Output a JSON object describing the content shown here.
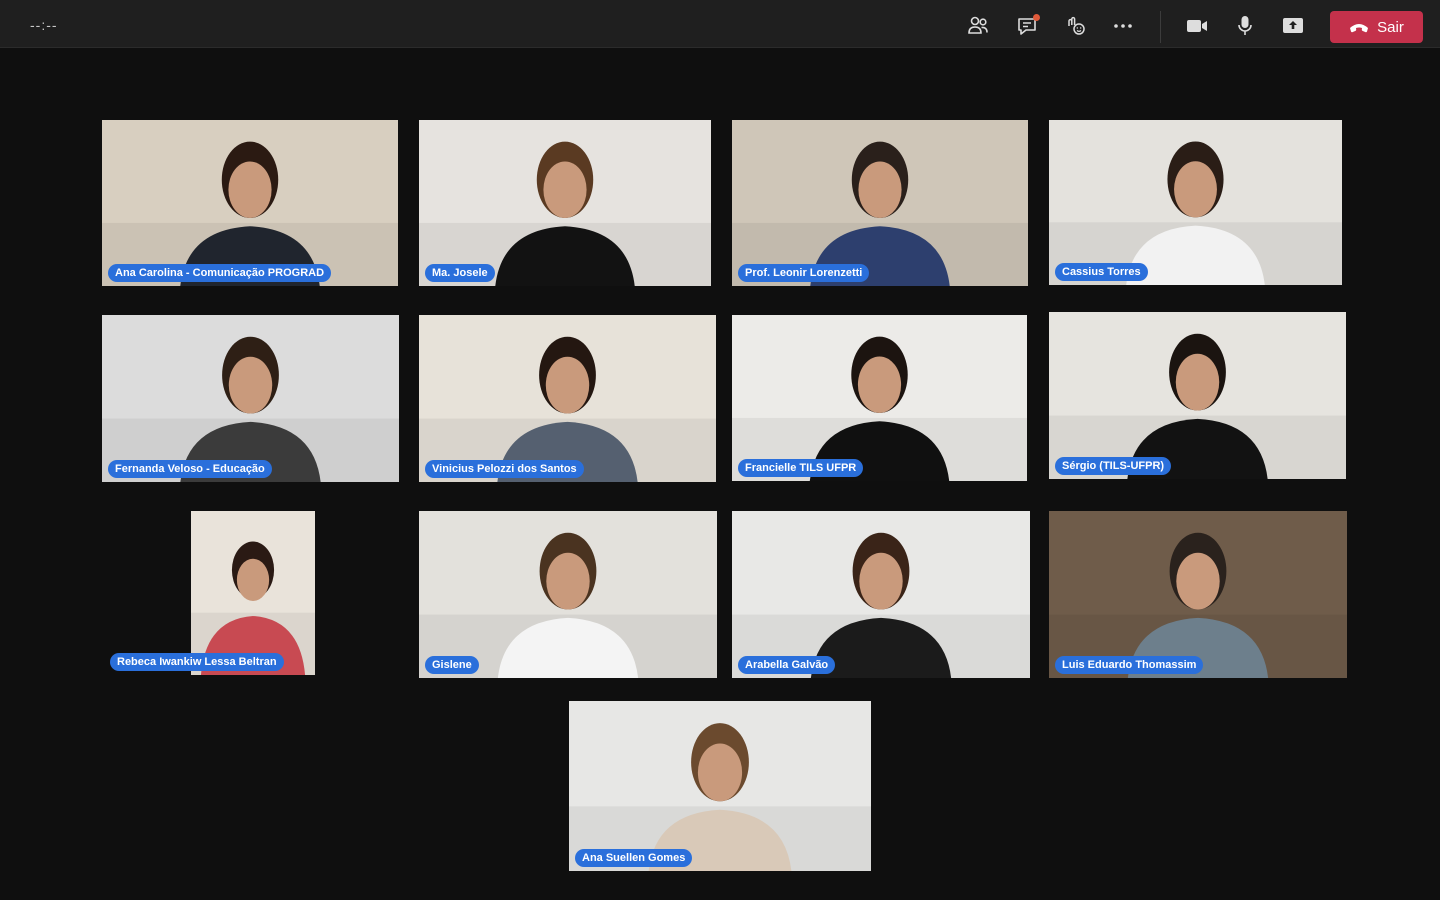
{
  "meeting": {
    "timer": "--:--",
    "toolbar": {
      "people_icon": "people-icon",
      "chat_icon": "chat-icon",
      "reactions_icon": "reactions-icon",
      "more_icon": "more-options-icon",
      "camera_icon": "camera-icon",
      "mic_icon": "microphone-icon",
      "share_icon": "share-screen-icon",
      "leave_label": "Sair",
      "leave_color": "#c4314b"
    }
  },
  "participants": [
    {
      "name": "Ana Carolina - Comunicação PROGRAD",
      "wall": "#d8cfc0",
      "shirt": "#20252e",
      "hair": "#2b1a12"
    },
    {
      "name": "Ma. Josele",
      "wall": "#e6e3df",
      "shirt": "#121212",
      "hair": "#5a3a22"
    },
    {
      "name": "Prof. Leonir Lorenzetti",
      "wall": "#cfc6b8",
      "shirt": "#2d3f6e",
      "hair": "#2a201b"
    },
    {
      "name": "Cassius Torres",
      "wall": "#e4e2dd",
      "shirt": "#f2f2f2",
      "hair": "#2a1d16"
    },
    {
      "name": "Fernanda Veloso - Educação",
      "wall": "#dcdcdc",
      "shirt": "#3b3b3b",
      "hair": "#2e1f15"
    },
    {
      "name": "Vinicius Pelozzi dos Santos",
      "wall": "#e7e2d9",
      "shirt": "#556070",
      "hair": "#241711"
    },
    {
      "name": "Francielle TILS UFPR",
      "wall": "#ecebe8",
      "shirt": "#101010",
      "hair": "#1c1410"
    },
    {
      "name": "Sérgio (TILS-UFPR)",
      "wall": "#e6e4df",
      "shirt": "#121212",
      "hair": "#1b1410"
    },
    {
      "name": "Rebeca Iwankiw Lessa Beltran",
      "wall": "#e9e3da",
      "shirt": "#c84a52",
      "hair": "#2a1a14"
    },
    {
      "name": "Gislene",
      "wall": "#e3e1dc",
      "shirt": "#f4f4f4",
      "hair": "#4a3320"
    },
    {
      "name": "Arabella Galvão",
      "wall": "#e8e8e6",
      "shirt": "#1b1b1b",
      "hair": "#3a2418"
    },
    {
      "name": "Luis Eduardo Thomassim",
      "wall": "#6f5c4a",
      "shirt": "#6d7f8c",
      "hair": "#2a221d"
    },
    {
      "name": "Ana Suellen Gomes",
      "wall": "#e7e7e5",
      "shirt": "#d9c9b8",
      "hair": "#6b4a2e"
    }
  ]
}
